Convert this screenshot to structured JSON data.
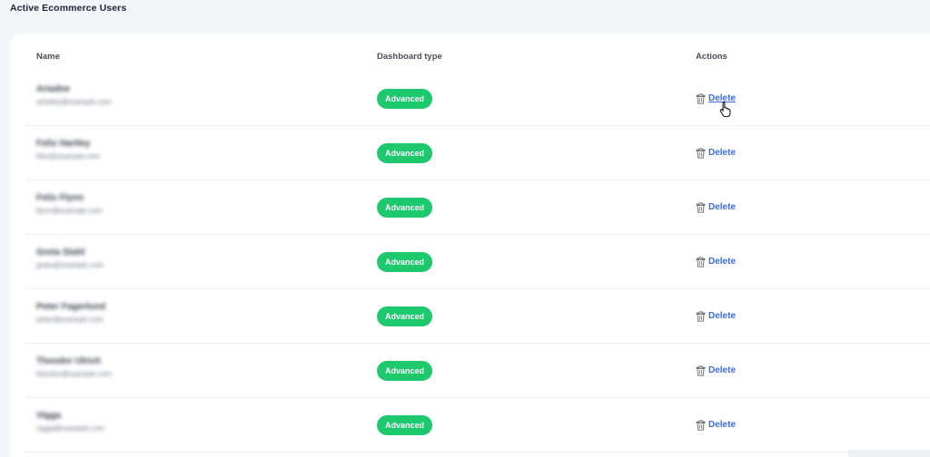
{
  "page": {
    "title": "Active Ecommerce Users"
  },
  "table": {
    "headers": {
      "name": "Name",
      "dashboard_type": "Dashboard type",
      "actions": "Actions"
    },
    "rows": [
      {
        "name": "Ariadne",
        "email": "ariadne@example.com",
        "dashboard_type": "Advanced",
        "action_label": "Delete"
      },
      {
        "name": "Felix Hartley",
        "email": "felix@example.com",
        "dashboard_type": "Advanced",
        "action_label": "Delete"
      },
      {
        "name": "Felix Flynn",
        "email": "flynn@example.com",
        "dashboard_type": "Advanced",
        "action_label": "Delete"
      },
      {
        "name": "Greta Stahl",
        "email": "greta@example.com",
        "dashboard_type": "Advanced",
        "action_label": "Delete"
      },
      {
        "name": "Peter Fagerlund",
        "email": "peter@example.com",
        "dashboard_type": "Advanced",
        "action_label": "Delete"
      },
      {
        "name": "Theodor Ulrich",
        "email": "theodor@example.com",
        "dashboard_type": "Advanced",
        "action_label": "Delete"
      },
      {
        "name": "Vigga",
        "email": "vigga@example.com",
        "dashboard_type": "Advanced",
        "action_label": "Delete"
      }
    ]
  },
  "colors": {
    "badge": "#1ec86d",
    "link": "#3d6be0",
    "background": "#f4f5f8"
  },
  "icons": {
    "action_icon": "trash-icon",
    "cursor": "hand-pointer-cursor"
  }
}
